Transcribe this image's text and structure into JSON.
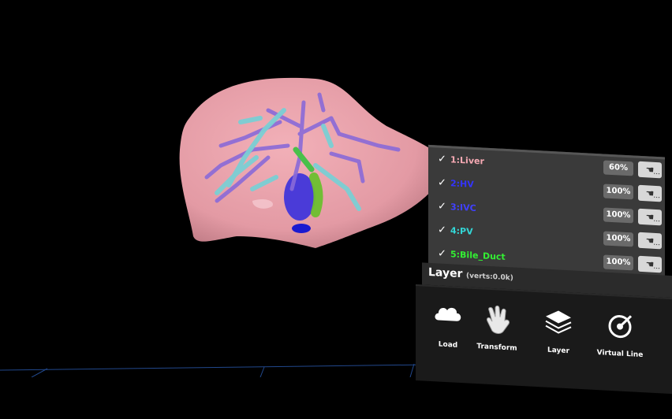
{
  "layers": [
    {
      "label": "1:Liver",
      "color": "#f6a9b3",
      "opacity": "60%",
      "checked": true
    },
    {
      "label": "2:HV",
      "color": "#3333ff",
      "opacity": "100%",
      "checked": true
    },
    {
      "label": "3:IVC",
      "color": "#4040ff",
      "opacity": "100%",
      "checked": true
    },
    {
      "label": "4:PV",
      "color": "#33d6d6",
      "opacity": "100%",
      "checked": true
    },
    {
      "label": "5:Bile_Duct",
      "color": "#33ee33",
      "opacity": "100%",
      "checked": true
    }
  ],
  "panel": {
    "title": "Layer",
    "verts": "(verts:0.0k)"
  },
  "tools": [
    {
      "label": "Load",
      "icon": "cloud-icon"
    },
    {
      "label": "Transform",
      "icon": "hand-icon"
    },
    {
      "label": "Layer",
      "icon": "layers-icon"
    },
    {
      "label": "Virtual Line",
      "icon": "target-icon"
    }
  ],
  "check_glyph": "✓",
  "hand_glyph": "☚",
  "dots": "...",
  "close_glyph": "✕"
}
